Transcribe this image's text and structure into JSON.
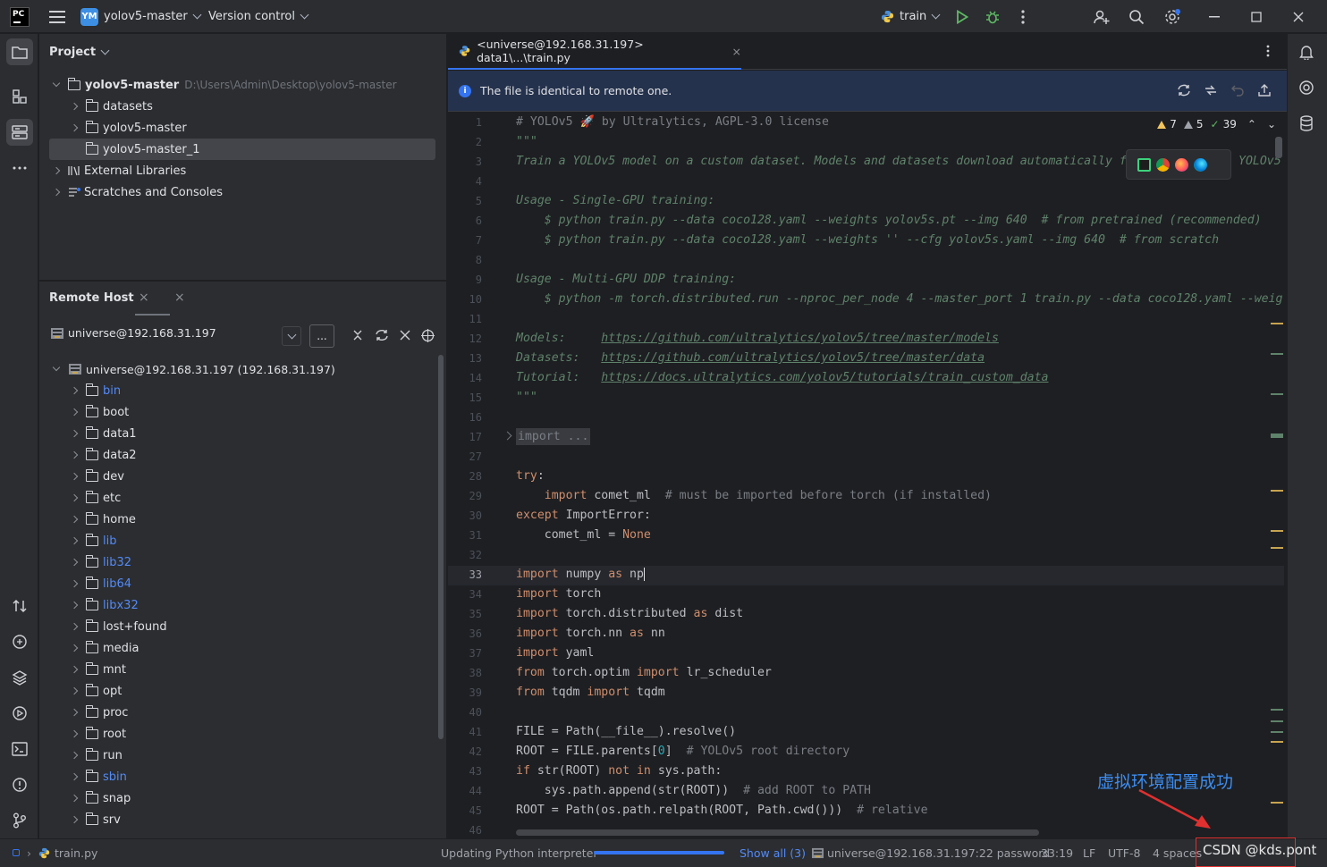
{
  "titlebar": {
    "logo": "PC",
    "project_badge": "YM",
    "project_name": "yolov5-master",
    "vcs": "Version control",
    "run_config": "train"
  },
  "project_panel": {
    "title": "Project",
    "root": {
      "name": "yolov5-master",
      "path": "D:\\Users\\Admin\\Desktop\\yolov5-master"
    },
    "children": [
      "datasets",
      "yolov5-master",
      "yolov5-master_1"
    ],
    "external": "External Libraries",
    "scratches": "Scratches and Consoles"
  },
  "remote_panel": {
    "title": "Remote Host",
    "connection": "universe@192.168.31.197",
    "more_button": "...",
    "root": "universe@192.168.31.197 (192.168.31.197)",
    "folders": [
      {
        "name": "bin",
        "link": true
      },
      {
        "name": "boot",
        "link": false
      },
      {
        "name": "data1",
        "link": false
      },
      {
        "name": "data2",
        "link": false
      },
      {
        "name": "dev",
        "link": false
      },
      {
        "name": "etc",
        "link": false
      },
      {
        "name": "home",
        "link": false
      },
      {
        "name": "lib",
        "link": true
      },
      {
        "name": "lib32",
        "link": true
      },
      {
        "name": "lib64",
        "link": true
      },
      {
        "name": "libx32",
        "link": true
      },
      {
        "name": "lost+found",
        "link": false
      },
      {
        "name": "media",
        "link": false
      },
      {
        "name": "mnt",
        "link": false
      },
      {
        "name": "opt",
        "link": false
      },
      {
        "name": "proc",
        "link": false
      },
      {
        "name": "root",
        "link": false
      },
      {
        "name": "run",
        "link": false
      },
      {
        "name": "sbin",
        "link": true
      },
      {
        "name": "snap",
        "link": false
      },
      {
        "name": "srv",
        "link": false
      }
    ]
  },
  "editor": {
    "tab_label": "<universe@192.168.31.197> data1\\...\\train.py",
    "banner": "The file is identical to remote one.",
    "inspections": {
      "warnings": "7",
      "weak_warnings": "5",
      "typos": "39"
    },
    "current_line": "33",
    "line_numbers": [
      "1",
      "2",
      "3",
      "4",
      "5",
      "6",
      "7",
      "8",
      "9",
      "10",
      "11",
      "12",
      "13",
      "14",
      "15",
      "16",
      "17",
      "27",
      "28",
      "29",
      "30",
      "31",
      "32",
      "33",
      "34",
      "35",
      "36",
      "37",
      "38",
      "39",
      "40",
      "41",
      "42",
      "43",
      "44",
      "45",
      "46"
    ]
  },
  "status": {
    "breadcrumb_file": "train.py",
    "task": "Updating Python interpreter",
    "task_progress": 1.0,
    "show_all": "Show all (3)",
    "interpreter": "universe@192.168.31.197:22 password",
    "position": "33:19",
    "line_sep": "LF",
    "encoding": "UTF-8",
    "indent": "4 spaces"
  },
  "annotation": {
    "text": "虚拟环境配置成功",
    "watermark": "CSDN @kds.pont"
  },
  "colors": {
    "accent": "#3574f0",
    "keyword": "#cf8e6d",
    "comment": "#7a7e85",
    "docstring": "#5f826b",
    "annotation_red": "#e03030",
    "annotation_blue": "#3c8cf0"
  }
}
